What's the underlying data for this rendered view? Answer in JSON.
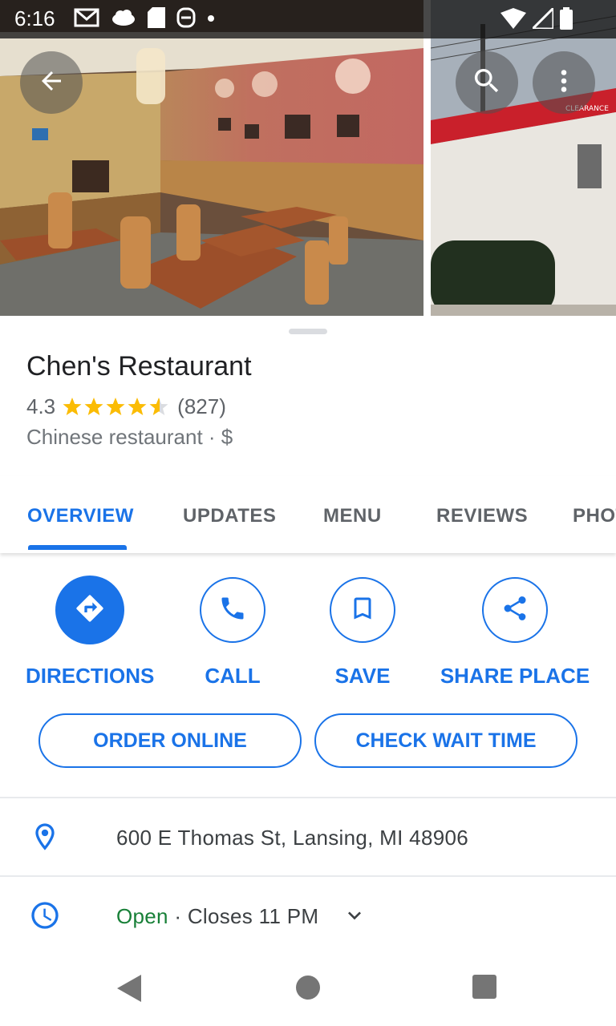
{
  "status_bar": {
    "time": "6:16",
    "notification_icons": [
      "gmail-icon",
      "cloud-icon",
      "sd-card-icon",
      "app-icon",
      "dot-icon"
    ],
    "right_icons": [
      "wifi-icon",
      "signal-icon",
      "battery-icon"
    ]
  },
  "header": {
    "back_icon": "arrow-back-icon",
    "search_icon": "search-icon",
    "more_icon": "more-vert-icon"
  },
  "place": {
    "name": "Chen's Restaurant",
    "rating": "4.3",
    "rating_value": 4.3,
    "reviews_count": "(827)",
    "category": "Chinese restaurant · $"
  },
  "tabs": [
    {
      "label": "OVERVIEW",
      "active": true
    },
    {
      "label": "UPDATES",
      "active": false
    },
    {
      "label": "MENU",
      "active": false
    },
    {
      "label": "REVIEWS",
      "active": false
    },
    {
      "label": "PHOTOS",
      "active": false
    }
  ],
  "actions": [
    {
      "label": "DIRECTIONS",
      "icon": "directions-icon"
    },
    {
      "label": "CALL",
      "icon": "phone-icon"
    },
    {
      "label": "SAVE",
      "icon": "bookmark-icon"
    },
    {
      "label": "SHARE PLACE",
      "icon": "share-icon"
    }
  ],
  "buttons": {
    "order_online": "ORDER ONLINE",
    "check_wait_time": "CHECK WAIT TIME"
  },
  "info": {
    "address": "600 E Thomas St, Lansing, MI 48906",
    "hours_status": "Open",
    "hours_detail": " · Closes 11 PM"
  },
  "colors": {
    "accent": "#1a73e8",
    "open_green": "#188038",
    "star": "#fbbc04"
  }
}
